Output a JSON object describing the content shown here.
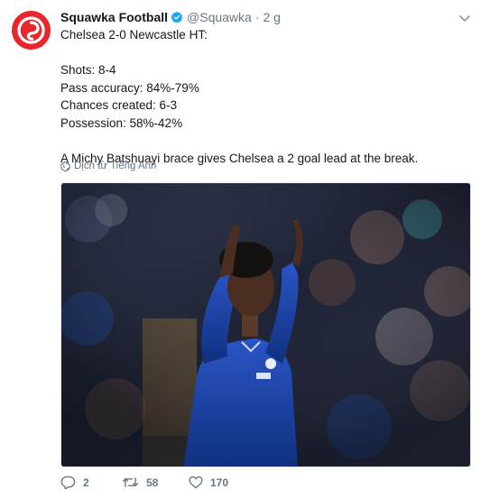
{
  "tweet": {
    "author_name": "Squawka Football",
    "handle": "@Squawka",
    "separator": "·",
    "time": "2 g",
    "lines": [
      "Chelsea 2-0 Newcastle HT:",
      "",
      "Shots: 8-4",
      "Pass accuracy: 84%-79%",
      "Chances created: 6-3",
      "Possession: 58%-42%",
      "",
      "A Michy Batshuayi brace gives Chelsea a 2 goal lead at the break."
    ],
    "translate_label": "Dịch từ Tiếng Anh"
  },
  "actions": {
    "replies": "2",
    "retweets": "58",
    "likes": "170"
  },
  "colors": {
    "brand": "#e8262b",
    "muted": "#657786",
    "verified": "#1da1f2",
    "text": "#14171a"
  },
  "icons": [
    "squawka-logo-icon",
    "verified-badge-icon",
    "chevron-down-icon",
    "globe-icon",
    "reply-icon",
    "retweet-icon",
    "like-icon"
  ]
}
